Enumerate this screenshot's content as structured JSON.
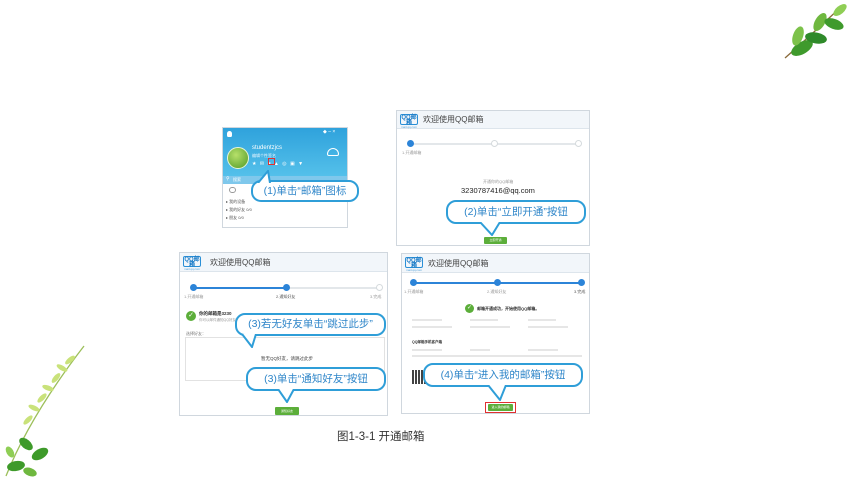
{
  "caption": "图1-3-1 开通邮箱",
  "qq_client": {
    "username": "studentzjcs",
    "status_text": "编辑个性签名",
    "search_placeholder": "搜索",
    "groups": [
      "我的设备",
      "我的好友 0/0",
      "朋友 0/0"
    ]
  },
  "mail_panel_1": {
    "logo_text": "QQ邮箱",
    "logo_sub": "mail.qq.com",
    "title": "欢迎使用QQ邮箱",
    "step_label": "1.开通邮箱",
    "info_label": "开通你的QQ邮箱",
    "email": "3230787416@qq.com",
    "button": "立即开通"
  },
  "mail_panel_2": {
    "logo_text": "QQ邮箱",
    "logo_sub": "mail.qq.com",
    "title": "欢迎使用QQ邮箱",
    "step1": "1.开通邮箱",
    "step2": "2.通知好友",
    "step3": "3.完成",
    "mailbox_label": "你的邮箱是3230",
    "notice": "你可以邮件通知QQ好友，邮件已成功",
    "friends_label": "选择好友：",
    "center_text": "暂无QQ好友，请跳过此步",
    "button": "通知好友"
  },
  "mail_panel_3": {
    "logo_text": "QQ邮箱",
    "logo_sub": "mail.qq.com",
    "title": "欢迎使用QQ邮箱",
    "step1": "1.开通邮箱",
    "step2": "2.通知好友",
    "step3": "3.完成",
    "success_text": "邮箱开通成功，开始使用QQ邮箱。",
    "section_heading": "QQ邮箱手机客户端",
    "button": "进入我的邮箱"
  },
  "callouts": {
    "c1": "(1)单击“邮箱”图标",
    "c2": "(2)单击“立即开通”按钮",
    "c3a": "(3)若无好友单击“跳过此步”",
    "c3b": "(3)单击“通知好友”按钮",
    "c4": "(4)单击“进入我的邮箱”按钮"
  },
  "colors": {
    "accent_blue": "#2c84d8",
    "callout_border": "#2f9ed8",
    "qq_green": "#6fbf3a",
    "button_green": "#5cae3a",
    "leaf_green": "#3f9a2c"
  }
}
